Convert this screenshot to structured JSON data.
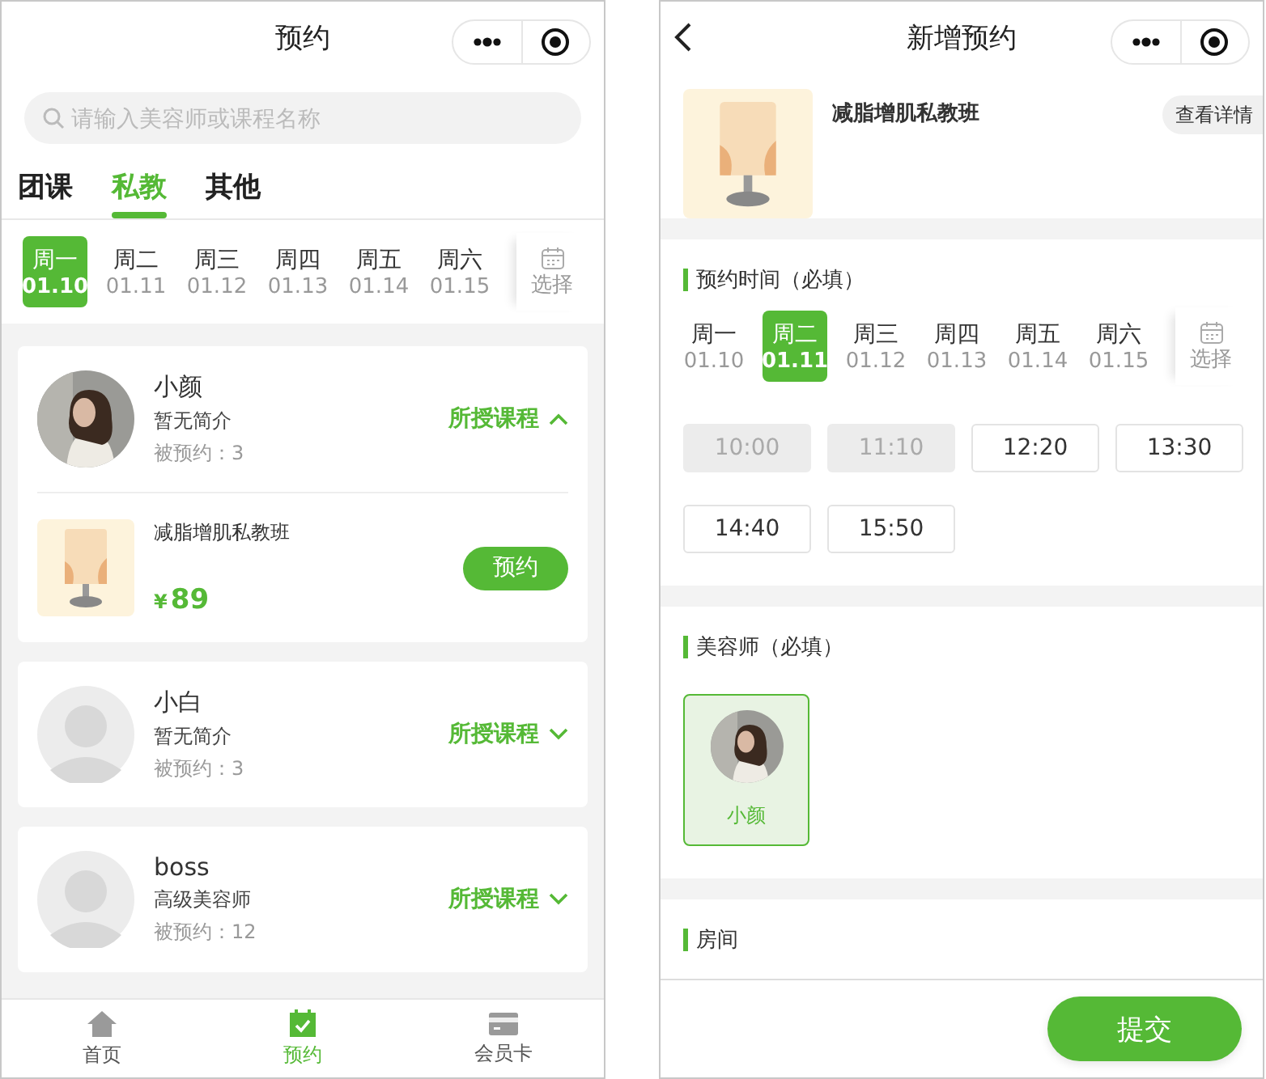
{
  "left": {
    "title": "预约",
    "search": {
      "placeholder": "请输入美容师或课程名称"
    },
    "tabs": [
      {
        "label": "团课",
        "selected": false
      },
      {
        "label": "私教",
        "selected": true
      },
      {
        "label": "其他",
        "selected": false
      }
    ],
    "days": [
      {
        "weekday": "周一",
        "date": "01.10",
        "selected": true
      },
      {
        "weekday": "周二",
        "date": "01.11",
        "selected": false
      },
      {
        "weekday": "周三",
        "date": "01.12",
        "selected": false
      },
      {
        "weekday": "周四",
        "date": "01.13",
        "selected": false
      },
      {
        "weekday": "周五",
        "date": "01.14",
        "selected": false
      },
      {
        "weekday": "周六",
        "date": "01.15",
        "selected": false
      }
    ],
    "date_picker": "选择",
    "teachers": [
      {
        "name": "小颜",
        "intro": "暂无简介",
        "booked": "被预约：3",
        "toggle": "所授课程",
        "expanded": true,
        "courses": [
          {
            "name": "减脂增肌私教班",
            "currency": "¥",
            "price": "89",
            "button": "预约"
          }
        ]
      },
      {
        "name": "小白",
        "intro": "暂无简介",
        "booked": "被预约：3",
        "toggle": "所授课程",
        "expanded": false,
        "kind": "default"
      },
      {
        "name": "boss",
        "intro": "高级美容师",
        "booked": "被预约：12",
        "toggle": "所授课程",
        "expanded": false,
        "kind": "default"
      }
    ],
    "nav": [
      {
        "label": "首页",
        "kind": "home",
        "selected": false
      },
      {
        "label": "预约",
        "kind": "calendar",
        "selected": true
      },
      {
        "label": "会员卡",
        "kind": "card",
        "selected": false
      }
    ]
  },
  "right": {
    "title": "新增预约",
    "course": {
      "name": "减脂增肌私教班",
      "details": "查看详情"
    },
    "time_section": "预约时间（必填）",
    "days": [
      {
        "weekday": "周一",
        "date": "01.10",
        "selected": false
      },
      {
        "weekday": "周二",
        "date": "01.11",
        "selected": true
      },
      {
        "weekday": "周三",
        "date": "01.12",
        "selected": false
      },
      {
        "weekday": "周四",
        "date": "01.13",
        "selected": false
      },
      {
        "weekday": "周五",
        "date": "01.14",
        "selected": false
      },
      {
        "weekday": "周六",
        "date": "01.15",
        "selected": false
      }
    ],
    "date_picker": "选择",
    "slots": [
      {
        "time": "10:00",
        "disabled": true
      },
      {
        "time": "11:10",
        "disabled": true
      },
      {
        "time": "12:20",
        "disabled": false
      },
      {
        "time": "13:30",
        "disabled": false
      },
      {
        "time": "14:40",
        "disabled": false
      },
      {
        "time": "15:50",
        "disabled": false
      }
    ],
    "beautician_section": "美容师（必填）",
    "beauticians": [
      {
        "name": "小颜",
        "selected": true
      }
    ],
    "room_section": "房间",
    "submit": "提交"
  }
}
